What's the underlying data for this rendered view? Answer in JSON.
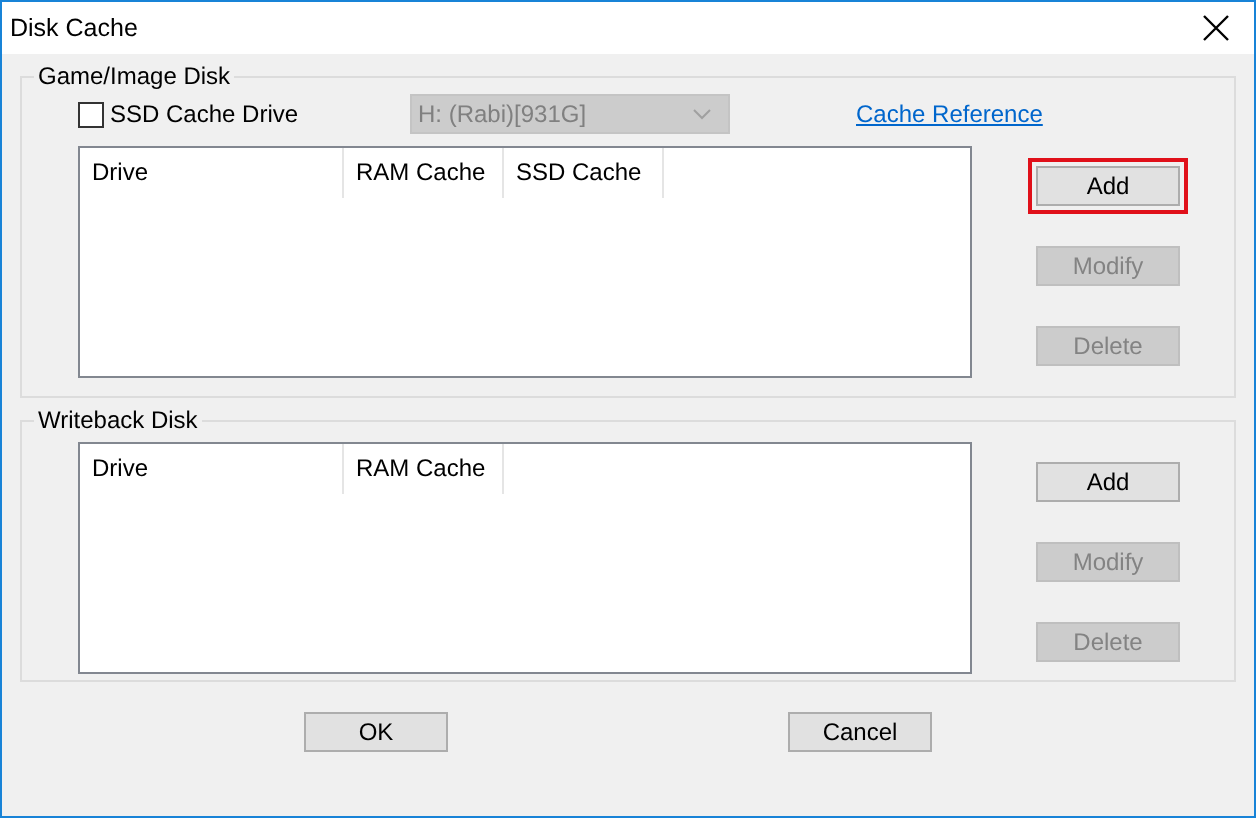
{
  "window": {
    "title": "Disk Cache"
  },
  "groups": [
    {
      "title": "Game/Image Disk",
      "ssd_option": {
        "label": "SSD Cache Drive",
        "checked": false
      },
      "drive_select": {
        "value": "H: (Rabi)[931G]",
        "disabled": true
      },
      "link": "Cache Reference",
      "columns": [
        "Drive",
        "RAM Cache",
        "SSD Cache"
      ],
      "buttons": [
        {
          "label": "Add",
          "disabled": false,
          "highlighted": true
        },
        {
          "label": "Modify",
          "disabled": true,
          "highlighted": false
        },
        {
          "label": "Delete",
          "disabled": true,
          "highlighted": false
        }
      ]
    },
    {
      "title": "Writeback Disk",
      "columns": [
        "Drive",
        "RAM Cache"
      ],
      "buttons": [
        {
          "label": "Add",
          "disabled": false,
          "highlighted": false
        },
        {
          "label": "Modify",
          "disabled": true,
          "highlighted": false
        },
        {
          "label": "Delete",
          "disabled": true,
          "highlighted": false
        }
      ]
    }
  ],
  "footer_buttons": [
    {
      "label": "OK"
    },
    {
      "label": "Cancel"
    }
  ]
}
